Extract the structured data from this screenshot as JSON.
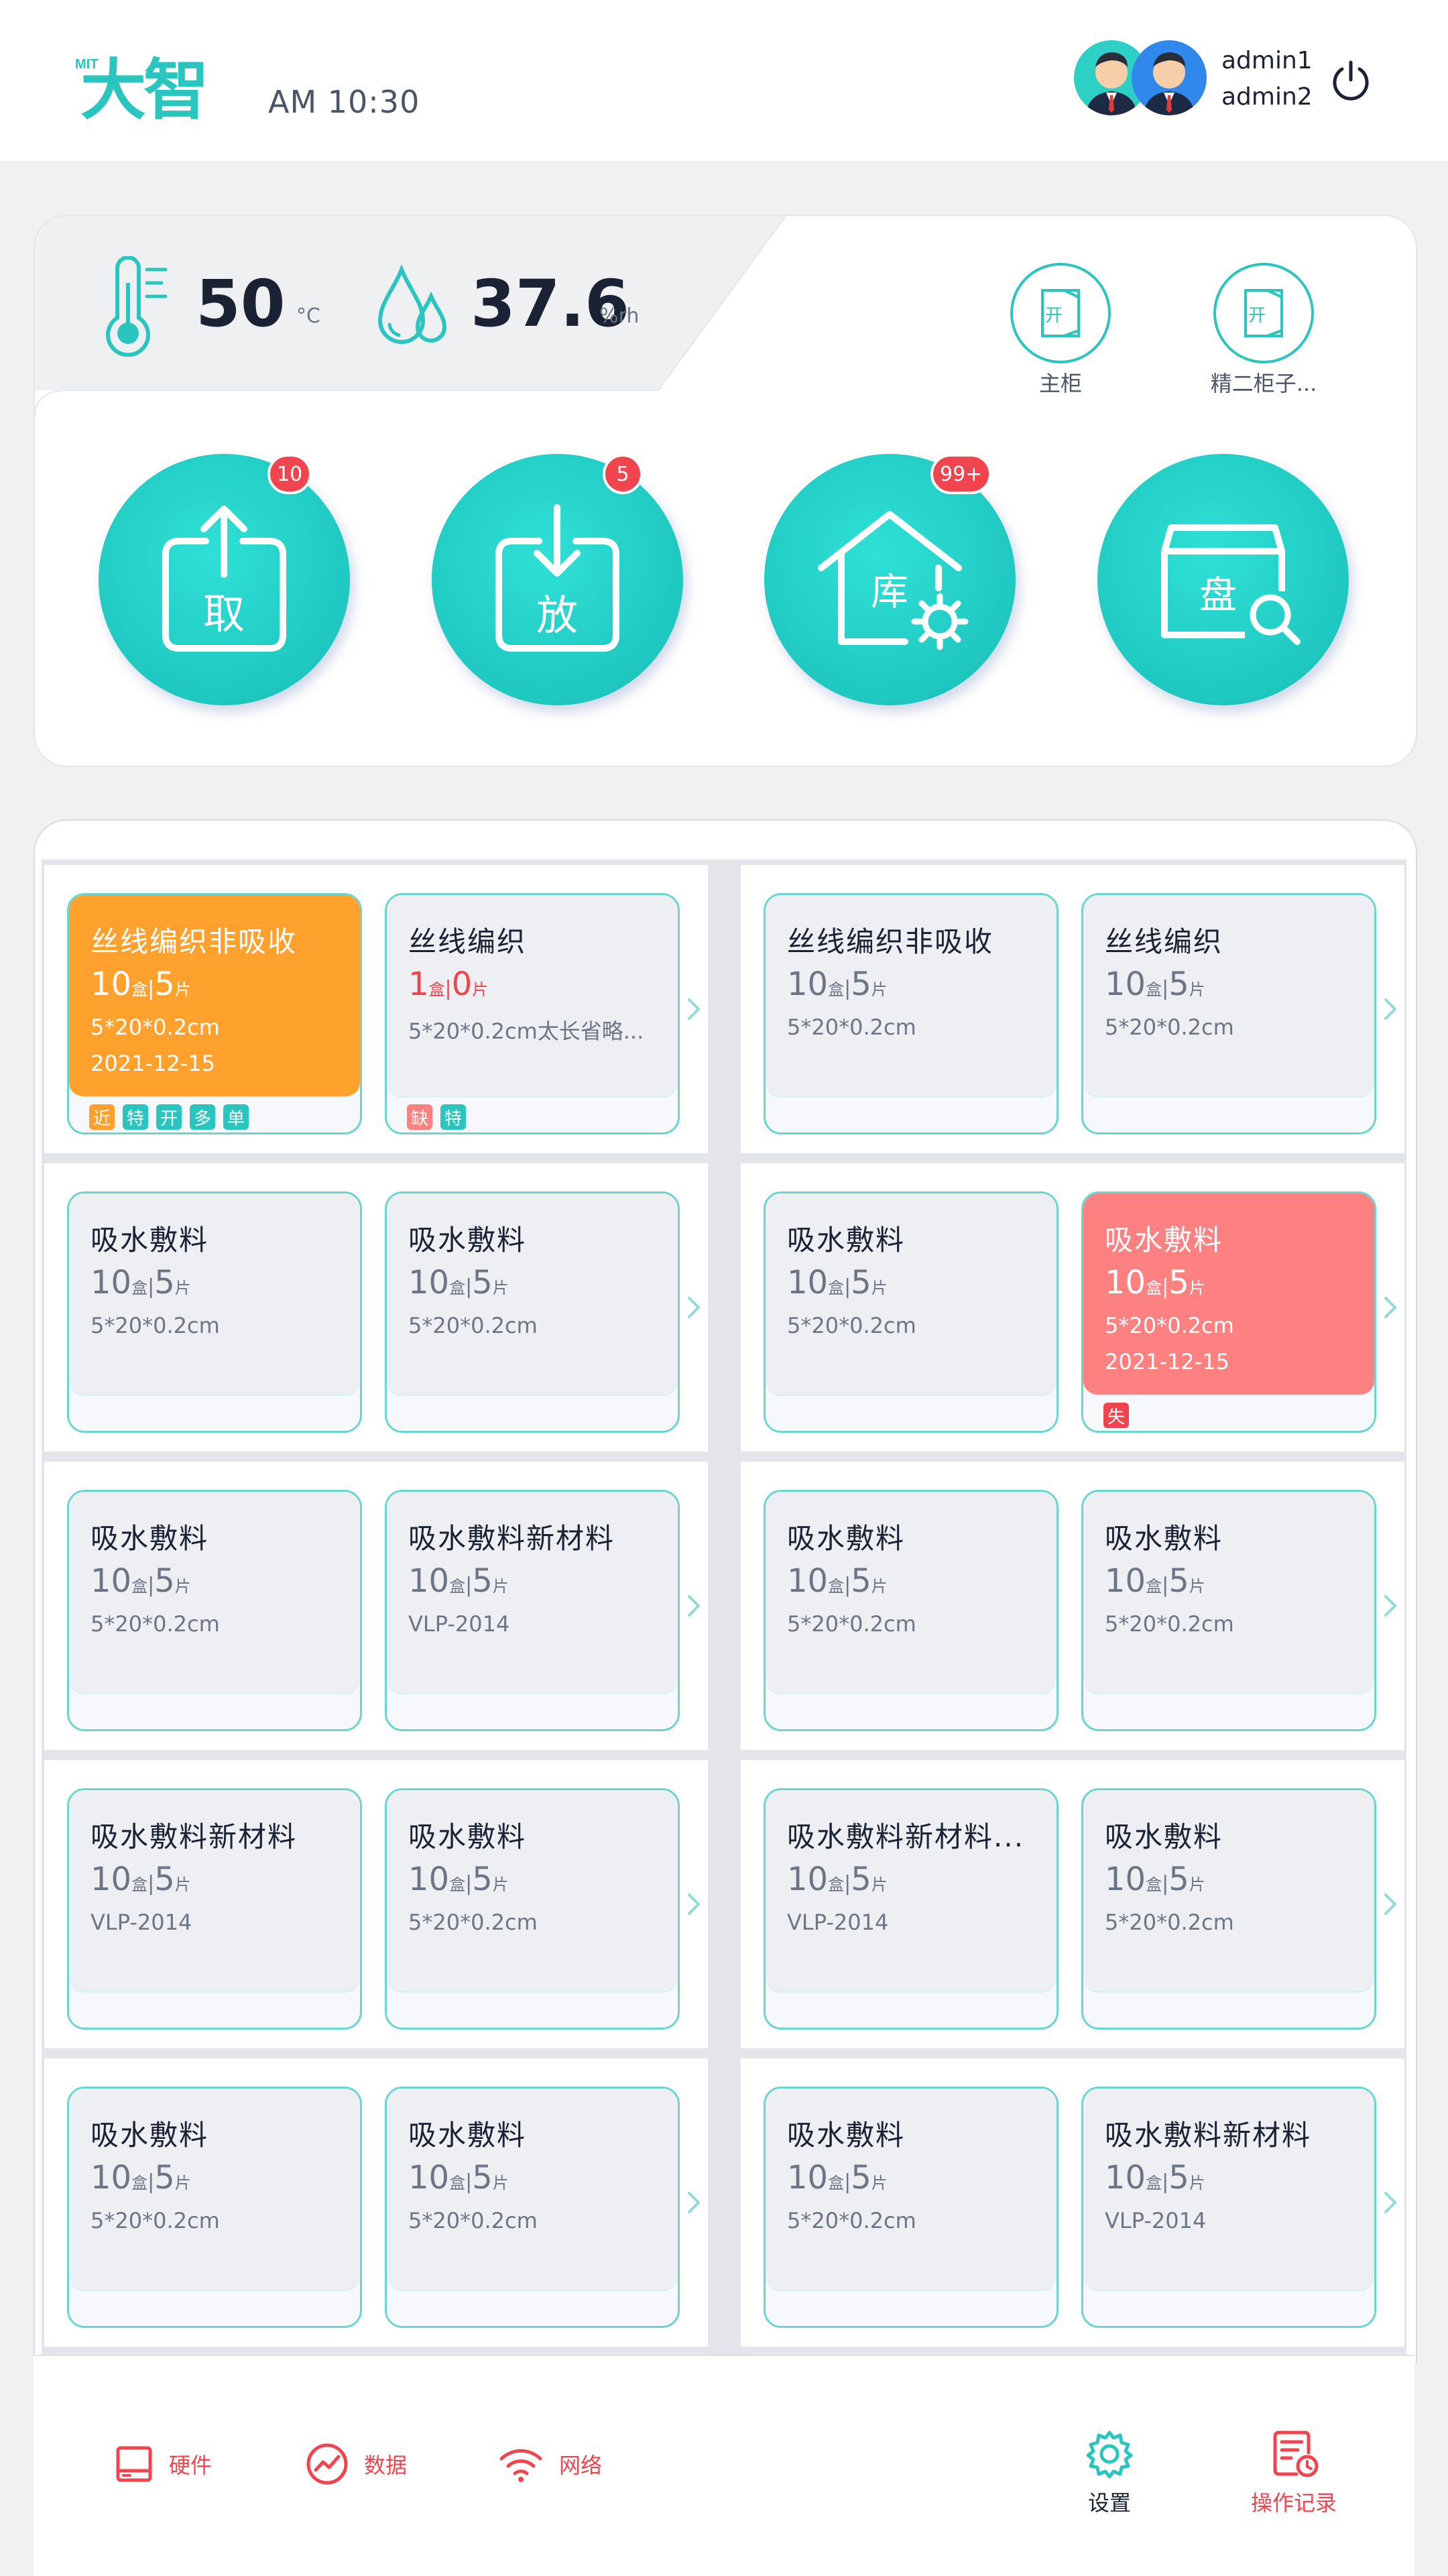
{
  "header": {
    "logo_text": "大智",
    "logo_brand": "MIT",
    "time": "AM 10:30",
    "users": [
      "admin1",
      "admin2"
    ]
  },
  "environment": {
    "temperature": "50",
    "temperature_unit": "°C",
    "humidity": "37.6",
    "humidity_unit": "%rh"
  },
  "doors": [
    {
      "icon_text": "开",
      "label": "主柜"
    },
    {
      "icon_text": "开",
      "label": "精二柜子..."
    }
  ],
  "actions": [
    {
      "label": "取",
      "badge": "10",
      "icon": "upload-box-icon"
    },
    {
      "label": "放",
      "badge": "5",
      "icon": "download-box-icon"
    },
    {
      "label": "库",
      "badge": "99+",
      "icon": "warehouse-gear-icon"
    },
    {
      "label": "盘",
      "badge": "",
      "icon": "box-search-icon"
    }
  ],
  "groups": [
    [
      {
        "title": "丝线编织非吸收",
        "qty_box": "10",
        "qty_box_unit": "盒",
        "qty_pcs": "5",
        "qty_pcs_unit": "片",
        "spec": "5*20*0.2cm",
        "date": "2021-12-15",
        "style": "orange",
        "tags": [
          "近",
          "特",
          "开",
          "多",
          "单"
        ]
      },
      {
        "title": "丝线编织",
        "qty_box": "1",
        "qty_box_unit": "盒",
        "qty_pcs": "0",
        "qty_pcs_unit": "片",
        "spec": "5*20*0.2cm太长省略...",
        "date": "",
        "style": "short",
        "tags": [
          "缺",
          "特"
        ]
      }
    ],
    [
      {
        "title": "丝线编织非吸收",
        "qty_box": "10",
        "qty_box_unit": "盒",
        "qty_pcs": "5",
        "qty_pcs_unit": "片",
        "spec": "5*20*0.2cm",
        "date": "",
        "style": "",
        "tags": []
      },
      {
        "title": "丝线编织",
        "qty_box": "10",
        "qty_box_unit": "盒",
        "qty_pcs": "5",
        "qty_pcs_unit": "片",
        "spec": "5*20*0.2cm",
        "date": "",
        "style": "",
        "tags": []
      }
    ],
    [
      {
        "title": "吸水敷料",
        "qty_box": "10",
        "qty_box_unit": "盒",
        "qty_pcs": "5",
        "qty_pcs_unit": "片",
        "spec": "5*20*0.2cm",
        "date": "",
        "style": "",
        "tags": []
      },
      {
        "title": "吸水敷料",
        "qty_box": "10",
        "qty_box_unit": "盒",
        "qty_pcs": "5",
        "qty_pcs_unit": "片",
        "spec": "5*20*0.2cm",
        "date": "",
        "style": "",
        "tags": []
      }
    ],
    [
      {
        "title": "吸水敷料",
        "qty_box": "10",
        "qty_box_unit": "盒",
        "qty_pcs": "5",
        "qty_pcs_unit": "片",
        "spec": "5*20*0.2cm",
        "date": "",
        "style": "",
        "tags": []
      },
      {
        "title": "吸水敷料",
        "qty_box": "10",
        "qty_box_unit": "盒",
        "qty_pcs": "5",
        "qty_pcs_unit": "片",
        "spec": "5*20*0.2cm",
        "date": "2021-12-15",
        "style": "red",
        "tags": [
          "失"
        ]
      }
    ],
    [
      {
        "title": "吸水敷料",
        "qty_box": "10",
        "qty_box_unit": "盒",
        "qty_pcs": "5",
        "qty_pcs_unit": "片",
        "spec": "5*20*0.2cm",
        "date": "",
        "style": "",
        "tags": []
      },
      {
        "title": "吸水敷料新材料",
        "qty_box": "10",
        "qty_box_unit": "盒",
        "qty_pcs": "5",
        "qty_pcs_unit": "片",
        "spec": "VLP-2014",
        "date": "",
        "style": "",
        "tags": []
      }
    ],
    [
      {
        "title": "吸水敷料",
        "qty_box": "10",
        "qty_box_unit": "盒",
        "qty_pcs": "5",
        "qty_pcs_unit": "片",
        "spec": "5*20*0.2cm",
        "date": "",
        "style": "",
        "tags": []
      },
      {
        "title": "吸水敷料",
        "qty_box": "10",
        "qty_box_unit": "盒",
        "qty_pcs": "5",
        "qty_pcs_unit": "片",
        "spec": "5*20*0.2cm",
        "date": "",
        "style": "",
        "tags": []
      }
    ],
    [
      {
        "title": "吸水敷料新材料",
        "qty_box": "10",
        "qty_box_unit": "盒",
        "qty_pcs": "5",
        "qty_pcs_unit": "片",
        "spec": "VLP-2014",
        "date": "",
        "style": "",
        "tags": []
      },
      {
        "title": "吸水敷料",
        "qty_box": "10",
        "qty_box_unit": "盒",
        "qty_pcs": "5",
        "qty_pcs_unit": "片",
        "spec": "5*20*0.2cm",
        "date": "",
        "style": "",
        "tags": []
      }
    ],
    [
      {
        "title": "吸水敷料新材料...",
        "qty_box": "10",
        "qty_box_unit": "盒",
        "qty_pcs": "5",
        "qty_pcs_unit": "片",
        "spec": "VLP-2014",
        "date": "",
        "style": "",
        "tags": []
      },
      {
        "title": "吸水敷料",
        "qty_box": "10",
        "qty_box_unit": "盒",
        "qty_pcs": "5",
        "qty_pcs_unit": "片",
        "spec": "5*20*0.2cm",
        "date": "",
        "style": "",
        "tags": []
      }
    ],
    [
      {
        "title": "吸水敷料",
        "qty_box": "10",
        "qty_box_unit": "盒",
        "qty_pcs": "5",
        "qty_pcs_unit": "片",
        "spec": "5*20*0.2cm",
        "date": "",
        "style": "",
        "tags": []
      },
      {
        "title": "吸水敷料",
        "qty_box": "10",
        "qty_box_unit": "盒",
        "qty_pcs": "5",
        "qty_pcs_unit": "片",
        "spec": "5*20*0.2cm",
        "date": "",
        "style": "",
        "tags": []
      }
    ],
    [
      {
        "title": "吸水敷料",
        "qty_box": "10",
        "qty_box_unit": "盒",
        "qty_pcs": "5",
        "qty_pcs_unit": "片",
        "spec": "5*20*0.2cm",
        "date": "",
        "style": "",
        "tags": []
      },
      {
        "title": "吸水敷料新材料",
        "qty_box": "10",
        "qty_box_unit": "盒",
        "qty_pcs": "5",
        "qty_pcs_unit": "片",
        "spec": "VLP-2014",
        "date": "",
        "style": "",
        "tags": []
      }
    ]
  ],
  "footer": {
    "left": [
      {
        "label": "硬件",
        "icon": "hardware-icon"
      },
      {
        "label": "数据",
        "icon": "chart-trend-icon"
      },
      {
        "label": "网络",
        "icon": "wifi-icon"
      }
    ],
    "settings_label": "设置",
    "log_label": "操作记录"
  },
  "colors": {
    "accent": "#29c5be",
    "alert": "#f0454f",
    "warning": "#ffa12c",
    "expired": "#fe8181",
    "card_bg": "#eeeff2"
  }
}
